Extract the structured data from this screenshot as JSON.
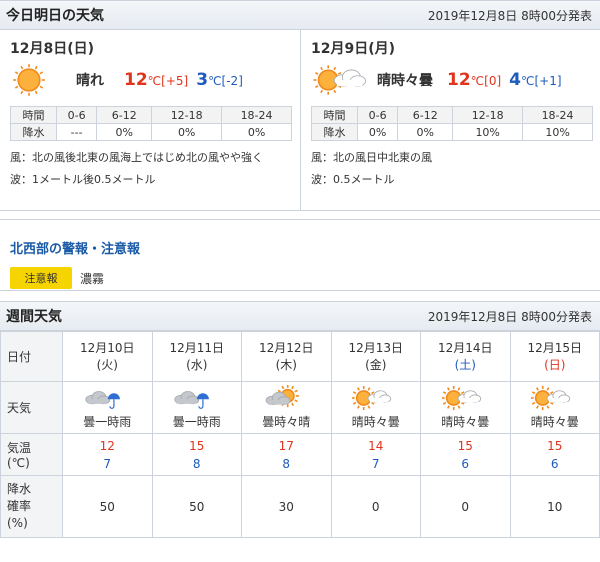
{
  "today_tomorrow": {
    "title": "今日明日の天気",
    "issued": "2019年12月8日 8時00分発表",
    "days": [
      {
        "date": "12月8日(日)",
        "weather": "晴れ",
        "icon": "sun",
        "high": "12",
        "high_diff": "[+5]",
        "low": "3",
        "low_diff": "[-2]",
        "unit": "℃",
        "rain_headers": [
          "時間",
          "0-6",
          "6-12",
          "12-18",
          "18-24"
        ],
        "rain_values": [
          "降水",
          "---",
          "0%",
          "0%",
          "0%"
        ],
        "wind": "風：北の風後北東の風海上ではじめ北の風やや強く",
        "wave": "波：1メートル後0.5メートル"
      },
      {
        "date": "12月9日(月)",
        "weather": "晴時々曇",
        "icon": "sun-cloud",
        "high": "12",
        "high_diff": "[0]",
        "low": "4",
        "low_diff": "[+1]",
        "unit": "℃",
        "rain_headers": [
          "時間",
          "0-6",
          "6-12",
          "12-18",
          "18-24"
        ],
        "rain_values": [
          "降水",
          "0%",
          "0%",
          "10%",
          "10%"
        ],
        "wind": "風：北の風日中北東の風",
        "wave": "波：0.5メートル"
      }
    ]
  },
  "warnings": {
    "title": "北西部の警報・注意報",
    "badge": "注意報",
    "text": "濃霧"
  },
  "weekly": {
    "title": "週間天気",
    "issued": "2019年12月8日 8時00分発表",
    "row_labels": {
      "date": "日付",
      "weather": "天気",
      "temp_1": "気温",
      "temp_2": "(℃)",
      "pop_1": "降水",
      "pop_2": "確率",
      "pop_3": "(%)"
    },
    "days": [
      {
        "date": "12月10日",
        "dow": "(火)",
        "dow_type": "weekday",
        "icon": "cloud-umbrella",
        "weather": "曇一時雨",
        "high": "12",
        "low": "7",
        "pop": "50"
      },
      {
        "date": "12月11日",
        "dow": "(水)",
        "dow_type": "weekday",
        "icon": "cloud-umbrella",
        "weather": "曇一時雨",
        "high": "15",
        "low": "8",
        "pop": "50"
      },
      {
        "date": "12月12日",
        "dow": "(木)",
        "dow_type": "weekday",
        "icon": "cloud-sun",
        "weather": "曇時々晴",
        "high": "17",
        "low": "8",
        "pop": "30"
      },
      {
        "date": "12月13日",
        "dow": "(金)",
        "dow_type": "weekday",
        "icon": "sun-cloud",
        "weather": "晴時々曇",
        "high": "14",
        "low": "7",
        "pop": "0"
      },
      {
        "date": "12月14日",
        "dow": "(土)",
        "dow_type": "sat",
        "icon": "sun-cloud",
        "weather": "晴時々曇",
        "high": "15",
        "low": "6",
        "pop": "0"
      },
      {
        "date": "12月15日",
        "dow": "(日)",
        "dow_type": "sun",
        "icon": "sun-cloud",
        "weather": "晴時々曇",
        "high": "15",
        "low": "6",
        "pop": "10"
      }
    ]
  },
  "colors": {
    "high_temp": "#e0341d",
    "low_temp": "#1f5bbf",
    "warning_badge": "#f5d400",
    "link": "#1a5aa6",
    "sun": "#f08a1c",
    "cloud": "#b9bcc2"
  }
}
